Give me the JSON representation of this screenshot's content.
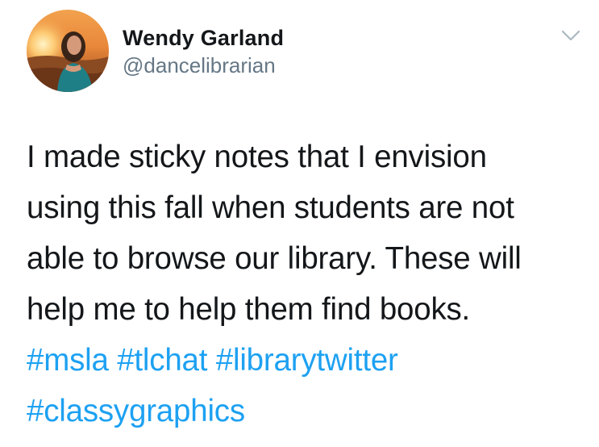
{
  "user": {
    "display_name": "Wendy Garland",
    "handle": "@dancelibrarian"
  },
  "tweet": {
    "text_lines": [
      "I made sticky notes that I envision",
      "using this fall when students are not",
      "able to browse our library. These will",
      "help me to help them find books."
    ],
    "hashtags": [
      "#msla",
      "#tlchat",
      "#librarytwitter",
      "#classygraphics"
    ]
  },
  "icons": {
    "menu": "chevron-down-icon",
    "avatar": "profile-photo"
  },
  "colors": {
    "text": "#14171a",
    "secondary": "#657786",
    "link": "#1da1f2",
    "chevron": "#aab8c2"
  }
}
